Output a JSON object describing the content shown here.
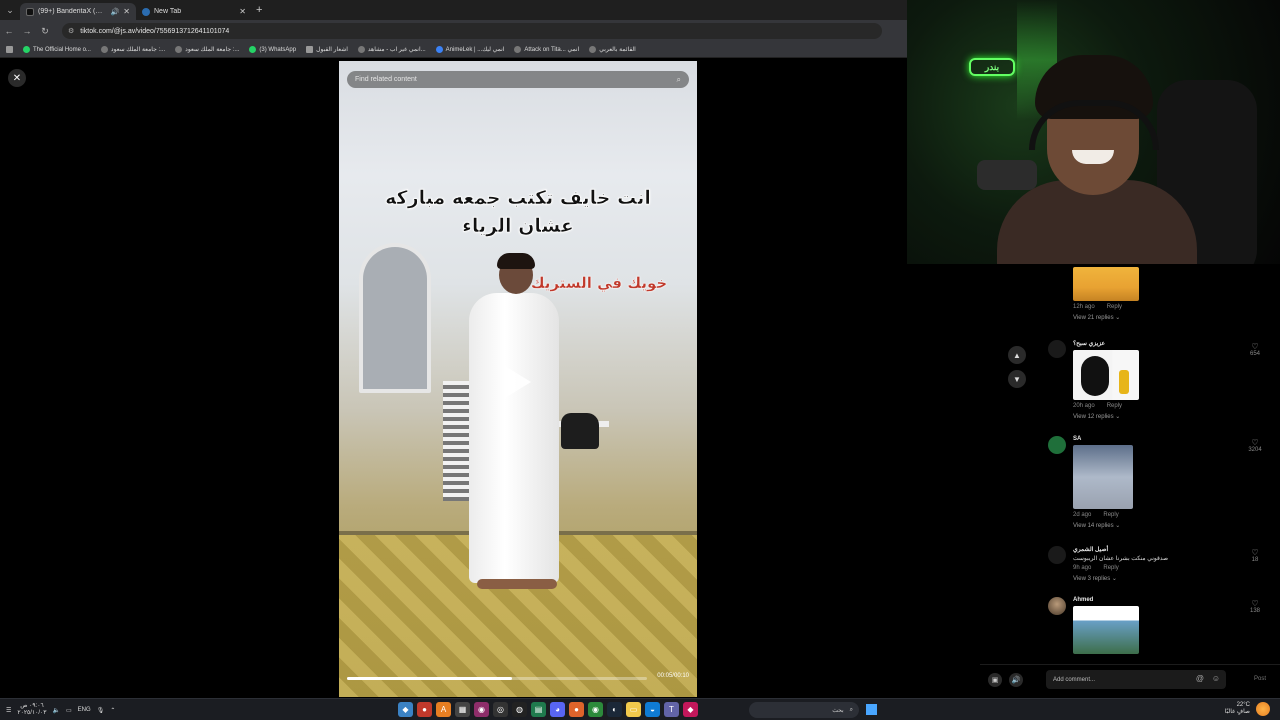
{
  "browser": {
    "tabs": [
      {
        "title": "(99+) BanderitaX (@bander...",
        "active": true
      },
      {
        "title": "New Tab",
        "active": false
      }
    ],
    "url": "tiktok.com/@js.av/video/7556913712641101074",
    "bookmarks": [
      "The Official Home o...",
      "جامعة الملك سعود :...",
      "جامعة الملك سعود :...",
      "(3) WhatsApp",
      "اشعار القبول",
      "انمي غير اب - مشاهد...",
      "AnimeLek | ...انمي ليك",
      "Attack on Tita... انمي",
      "القائمة بالعربي"
    ]
  },
  "video": {
    "search_placeholder": "Find related content",
    "caption_main": "انت خايف تكتب جمعه مباركه عشان الرياء",
    "caption_secondary": "خويك في الستريك",
    "time": "00:05/00:10",
    "progress": 0.55
  },
  "webcam": {
    "neon_sign": "ﺑﻨﺪﺭ"
  },
  "comments": [
    {
      "user": "",
      "text": "",
      "image": "food",
      "age": "12h ago",
      "reply": "Reply",
      "view_replies": "View 21 replies",
      "likes": ""
    },
    {
      "user": "عزيزي سبح؟",
      "text": "",
      "image": "silhouette",
      "age": "20h ago",
      "reply": "Reply",
      "view_replies": "View 12 replies",
      "likes": "654"
    },
    {
      "user": "SA",
      "text": "",
      "image": "boy",
      "age": "2d ago",
      "reply": "Reply",
      "view_replies": "View 14 replies",
      "likes": "3204"
    },
    {
      "user": "أصيل الشمري",
      "text": "صدقوني منكت بشرنا عشان الريبوست",
      "image": "",
      "age": "9h ago",
      "reply": "Reply",
      "view_replies": "View 3 replies",
      "likes": "18"
    },
    {
      "user": "Ahmed",
      "text": "",
      "image": "news",
      "age": "",
      "reply": "",
      "view_replies": "",
      "likes": "138"
    }
  ],
  "comment_input": {
    "placeholder": "Add comment...",
    "post": "Post"
  },
  "taskbar": {
    "time": "٠٩:٠٦ ص",
    "date": "٢٠٢٥/١٠/٠٣",
    "lang": "ENG",
    "search_label": "بحث",
    "weather_temp": "22°C",
    "weather_desc": "صافٍ غالبًا"
  }
}
